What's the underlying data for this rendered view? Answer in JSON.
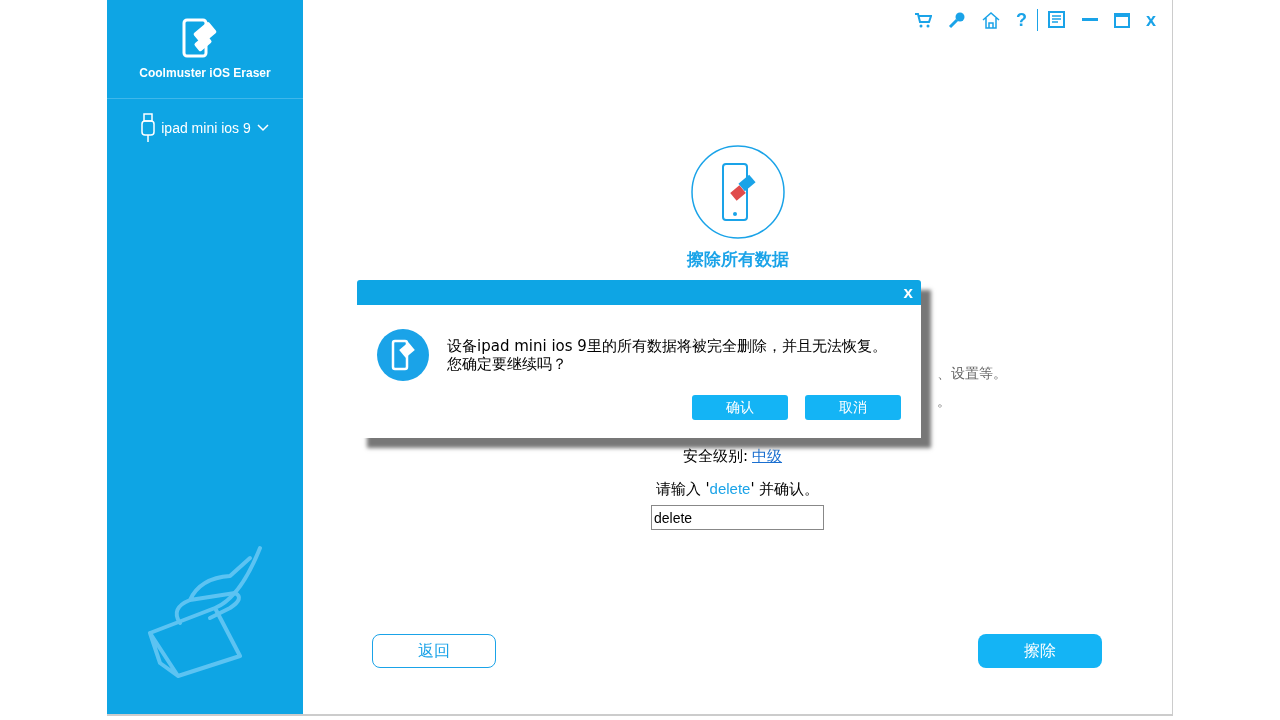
{
  "app": {
    "title": "Coolmuster iOS Eraser"
  },
  "sidebar": {
    "device": "ipad mini ios 9"
  },
  "toolbar": {
    "help": "?",
    "close": "x"
  },
  "main": {
    "title": "擦除所有数据",
    "description_fragments": [
      "、设置等。",
      "。"
    ],
    "security_label": "安全级别:",
    "security_level": "中级",
    "prompt_before": "请输入 '",
    "prompt_keyword": "delete",
    "prompt_after": "' 并确认。",
    "input_value": "delete",
    "back_button": "返回",
    "erase_button": "擦除"
  },
  "dialog": {
    "close": "x",
    "message": "设备ipad mini ios 9里的所有数据将被完全删除，并且无法恢复。您确定要继续吗？",
    "buttons": [
      "确认",
      "取消"
    ]
  }
}
